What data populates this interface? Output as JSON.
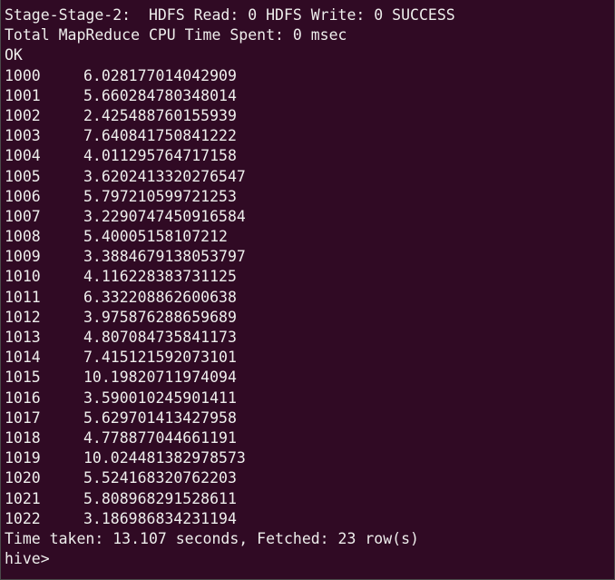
{
  "terminal": {
    "header_lines": [
      "Stage-Stage-2:  HDFS Read: 0 HDFS Write: 0 SUCCESS",
      "Total MapReduce CPU Time Spent: 0 msec",
      "OK"
    ],
    "rows": [
      {
        "id": "1000",
        "value": "6.028177014042909"
      },
      {
        "id": "1001",
        "value": "5.660284780348014"
      },
      {
        "id": "1002",
        "value": "2.425488760155939"
      },
      {
        "id": "1003",
        "value": "7.640841750841222"
      },
      {
        "id": "1004",
        "value": "4.011295764717158"
      },
      {
        "id": "1005",
        "value": "3.6202413320276547"
      },
      {
        "id": "1006",
        "value": "5.797210599721253"
      },
      {
        "id": "1007",
        "value": "3.2290747450916584"
      },
      {
        "id": "1008",
        "value": "5.40005158107212"
      },
      {
        "id": "1009",
        "value": "3.3884679138053797"
      },
      {
        "id": "1010",
        "value": "4.116228383731125"
      },
      {
        "id": "1011",
        "value": "6.332208862600638"
      },
      {
        "id": "1012",
        "value": "3.975876288659689"
      },
      {
        "id": "1013",
        "value": "4.807084735841173"
      },
      {
        "id": "1014",
        "value": "7.415121592073101"
      },
      {
        "id": "1015",
        "value": "10.19820711974094"
      },
      {
        "id": "1016",
        "value": "3.590010245901411"
      },
      {
        "id": "1017",
        "value": "5.629701413427958"
      },
      {
        "id": "1018",
        "value": "4.778877044661191"
      },
      {
        "id": "1019",
        "value": "10.024481382978573"
      },
      {
        "id": "1020",
        "value": "5.524168320762203"
      },
      {
        "id": "1021",
        "value": "5.808968291528611"
      },
      {
        "id": "1022",
        "value": "3.186986834231194"
      }
    ],
    "footer": "Time taken: 13.107 seconds, Fetched: 23 row(s)",
    "prompt": "hive>",
    "colors": {
      "background": "#300a24",
      "foreground": "#eeeeec"
    }
  }
}
